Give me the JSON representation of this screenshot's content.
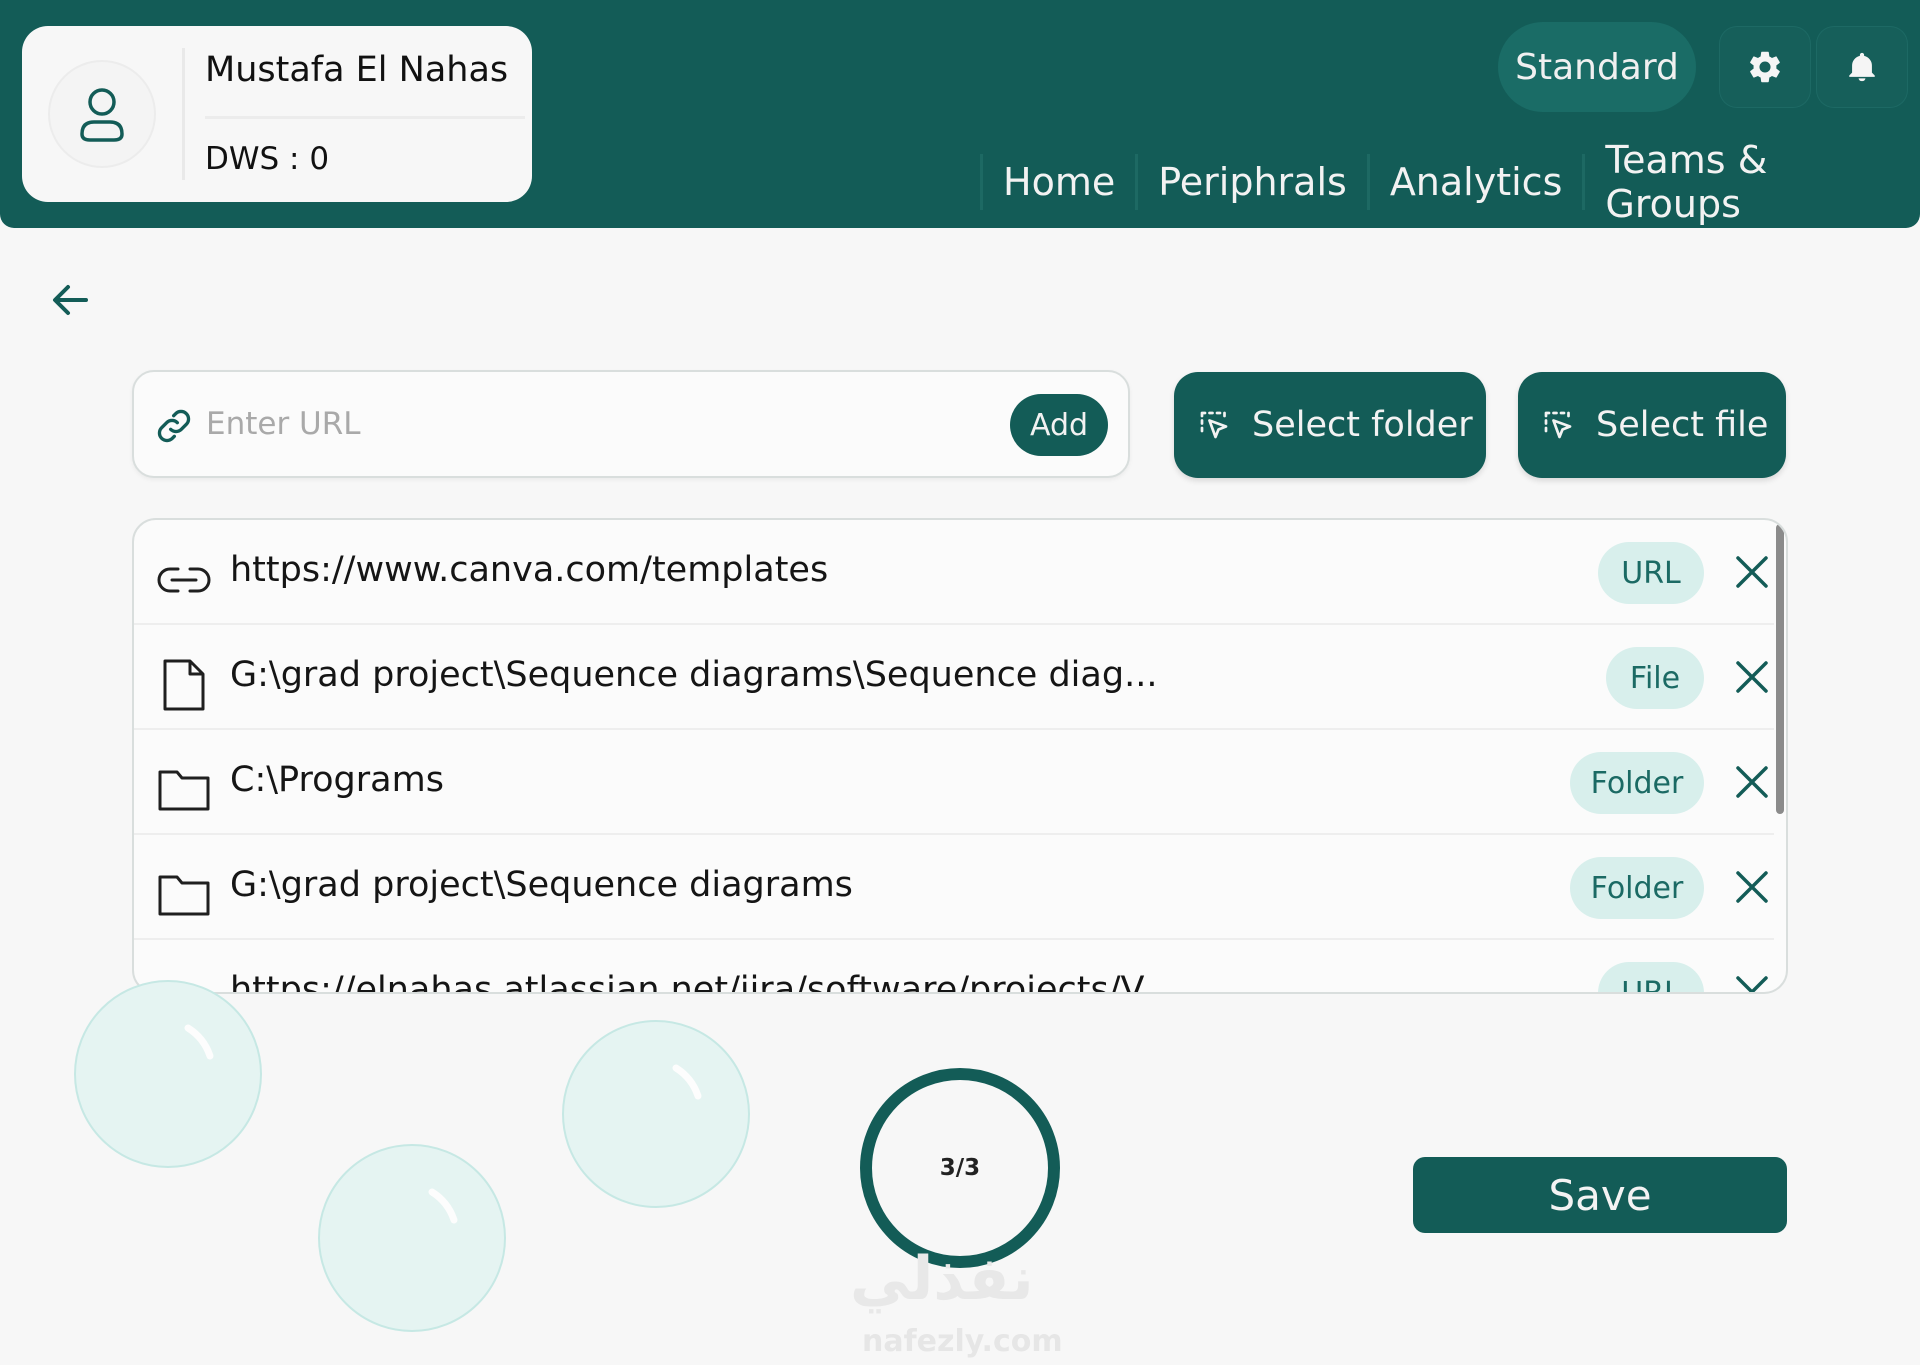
{
  "header": {
    "user_name": "Mustafa El Nahas",
    "dws": "DWS : 0",
    "plan": "Standard",
    "nav": [
      "Home",
      "Periphrals",
      "Analytics",
      "Teams & Groups"
    ]
  },
  "url_input": {
    "placeholder": "Enter URL",
    "add_label": "Add"
  },
  "select_folder_label": "Select folder",
  "select_file_label": "Select file",
  "items": [
    {
      "text": "https://www.canva.com/templates",
      "type": "URL",
      "icon": "link-icon"
    },
    {
      "text": "G:\\grad project\\Sequence diagrams\\Sequence diag...",
      "type": "File",
      "icon": "file-icon"
    },
    {
      "text": "C:\\Programs",
      "type": "Folder",
      "icon": "folder-icon"
    },
    {
      "text": "G:\\grad project\\Sequence diagrams",
      "type": "Folder",
      "icon": "folder-icon"
    },
    {
      "text": "https://elnahas.atlassian.net/jira/software/projects/V",
      "type": "URL",
      "icon": "link-icon"
    }
  ],
  "progress": {
    "text": "3/3",
    "fraction": 1.0
  },
  "save_label": "Save",
  "watermark": {
    "arabic": "نفذلي",
    "latin": "nafezly.com"
  },
  "colors": {
    "primary": "#135c57",
    "badge_bg": "#d8efec",
    "badge_text": "#1b6a64",
    "page_bg": "#f7f7f7"
  }
}
